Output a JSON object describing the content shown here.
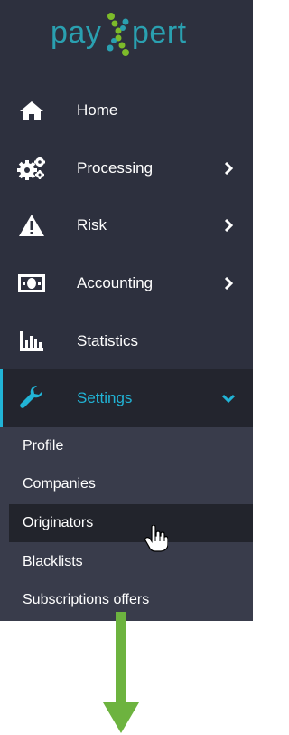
{
  "logo": {
    "left_text": "pay",
    "right_text": "pert",
    "brand_color": "#2aa0b0",
    "x_color": "#7dbb2a"
  },
  "nav": [
    {
      "label": "Home",
      "icon": "home-icon",
      "has_chevron": false
    },
    {
      "label": "Processing",
      "icon": "gears-icon",
      "has_chevron": true
    },
    {
      "label": "Risk",
      "icon": "warning-icon",
      "has_chevron": true
    },
    {
      "label": "Accounting",
      "icon": "money-icon",
      "has_chevron": true
    },
    {
      "label": "Statistics",
      "icon": "bar-chart-icon",
      "has_chevron": false
    },
    {
      "label": "Settings",
      "icon": "wrench-icon",
      "has_chevron": true,
      "active": true,
      "expanded": true
    }
  ],
  "submenu": [
    {
      "label": "Profile"
    },
    {
      "label": "Companies"
    },
    {
      "label": "Originators",
      "highlighted": true
    },
    {
      "label": "Blacklists"
    },
    {
      "label": "Subscriptions offers"
    }
  ],
  "colors": {
    "sidebar_bg": "#2d303e",
    "active_bg": "#23252e",
    "accent": "#21b4d6",
    "submenu_bg": "#393c4b",
    "highlight_bg": "#22242c",
    "arrow": "#6db33f"
  }
}
